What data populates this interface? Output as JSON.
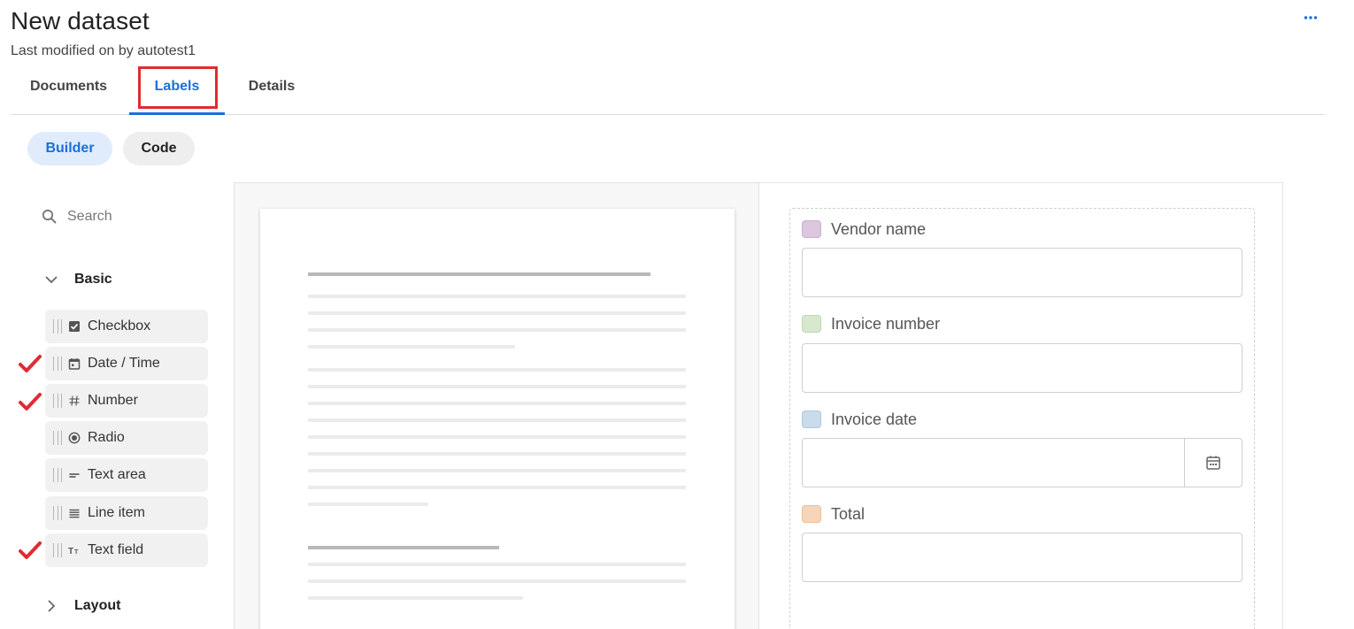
{
  "header": {
    "title": "New dataset",
    "subtitle": "Last modified on by autotest1",
    "more_label": "…"
  },
  "tabs": [
    {
      "label": "Documents"
    },
    {
      "label": "Labels",
      "active": true
    },
    {
      "label": "Details"
    }
  ],
  "mode_toggle": {
    "builder_label": "Builder",
    "code_label": "Code",
    "selected": "Builder"
  },
  "sidebar": {
    "search_placeholder": "Search",
    "groups": [
      {
        "label": "Basic",
        "expanded": true,
        "items": [
          {
            "label": "Checkbox",
            "icon": "checkbox-icon",
            "checked_annotation": false
          },
          {
            "label": "Date / Time",
            "icon": "calendar-icon",
            "checked_annotation": true
          },
          {
            "label": "Number",
            "icon": "hash-icon",
            "checked_annotation": true
          },
          {
            "label": "Radio",
            "icon": "radio-icon",
            "checked_annotation": false
          },
          {
            "label": "Text area",
            "icon": "text-area-icon",
            "checked_annotation": false
          },
          {
            "label": "Line item",
            "icon": "line-item-icon",
            "checked_annotation": false
          },
          {
            "label": "Text field",
            "icon": "text-field-icon",
            "checked_annotation": true
          }
        ]
      },
      {
        "label": "Layout",
        "expanded": false
      }
    ]
  },
  "form": {
    "fields": [
      {
        "label": "Vendor name",
        "color": "#dcc7df",
        "value": ""
      },
      {
        "label": "Invoice number",
        "color": "#d8e8cf",
        "value": ""
      },
      {
        "label": "Invoice date",
        "color": "#c9dcec",
        "value": "",
        "type": "date"
      },
      {
        "label": "Total",
        "color": "#f5d6bb",
        "value": ""
      }
    ]
  },
  "colors": {
    "accent": "#1a6fdc",
    "annotation_red": "#e02b34"
  }
}
